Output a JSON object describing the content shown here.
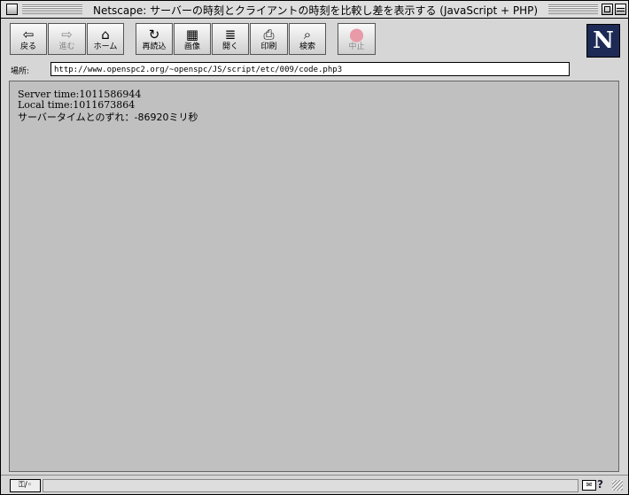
{
  "window": {
    "title": "Netscape: サーバーの時刻とクライアントの時刻を比較し差を表示する (JavaScript + PHP)"
  },
  "toolbar": {
    "back": "戻る",
    "forward": "進む",
    "home": "ホーム",
    "reload": "再読込",
    "images": "画像",
    "open": "開く",
    "print": "印刷",
    "find": "検索",
    "stop": "中止",
    "icons": {
      "back": "⇦",
      "forward": "⇨",
      "home": "⌂",
      "reload": "↻",
      "images": "▦",
      "open": "≣",
      "print": "⎙",
      "find": "⌕",
      "stop": "⬤"
    },
    "logo": "N",
    "stop_color": "#e89aa8"
  },
  "location": {
    "label": "場所:",
    "url": "http://www.openspc2.org/~openspc/JS/script/etc/009/code.php3"
  },
  "content": {
    "server_time": "Server time:1011586944",
    "local_time": "Local time:1011673864",
    "diff": "サーバータイムとのずれ：-86920ミリ秒"
  },
  "status": {
    "security": "⚿/◦",
    "mail_icon": "✉",
    "help_icon": "?"
  }
}
